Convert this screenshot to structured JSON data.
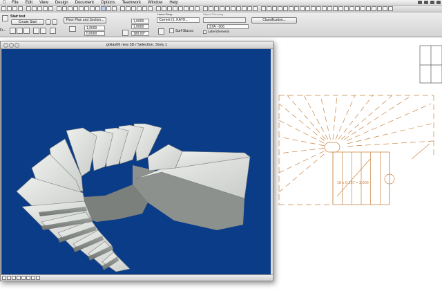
{
  "menubar": {
    "apple": "",
    "items": [
      "File",
      "Edit",
      "View",
      "Design",
      "Document",
      "Options",
      "Teamwork",
      "Window",
      "Help"
    ]
  },
  "infobox": {
    "tool_name": "Stair test",
    "create_button": "Create Stair",
    "floor_plan_button": "Floor Plan and Section...",
    "home_story_label": "Home Story:",
    "home_story_value": "Current (1. KATO...",
    "object_trimming_label": "Object Trimming",
    "classification_button": "Classification...",
    "value_a": "1,0000",
    "value_b": "1,0000",
    "value_c": "1,0000",
    "value_d": "0,0000",
    "value_e": "180,00°",
    "surface_label": "Surf-Stucco",
    "id_value": "STA - 006",
    "label_elements": "Label Elements",
    "geometry_short": "Fr..."
  },
  "window3d": {
    "title": "golias06 new 3D / Selection, Story 1"
  },
  "plan": {
    "dimension_text": "18 x 0,167 = 3,000"
  },
  "colors": {
    "viewport_bg": "#0b3c88",
    "stair_line": "#c8823e",
    "plan_line": "#555555"
  }
}
